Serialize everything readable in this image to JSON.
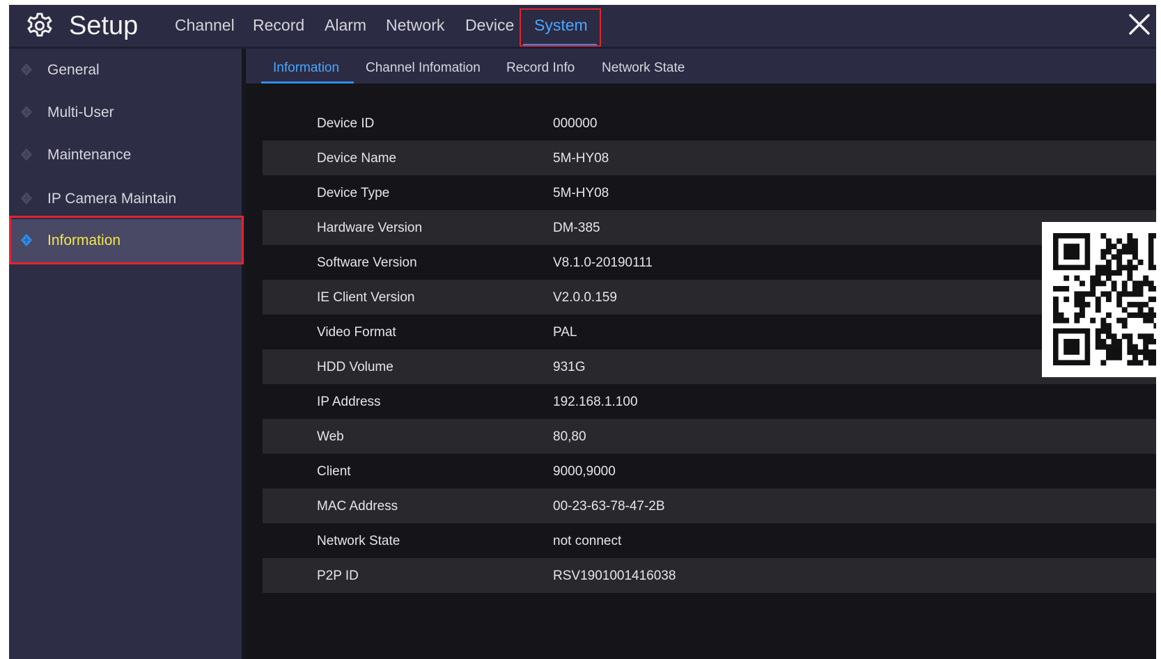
{
  "header": {
    "title": "Setup",
    "nav_tabs": [
      {
        "label": "Channel"
      },
      {
        "label": "Record"
      },
      {
        "label": "Alarm"
      },
      {
        "label": "Network"
      },
      {
        "label": "Device"
      },
      {
        "label": "System"
      }
    ],
    "active_tab": "System",
    "icons": {
      "settings": "gear-icon",
      "close": "close-icon"
    }
  },
  "sidebar": {
    "items": [
      {
        "label": "General"
      },
      {
        "label": "Multi-User"
      },
      {
        "label": "Maintenance"
      },
      {
        "label": "IP Camera Maintain"
      },
      {
        "label": "Information"
      }
    ],
    "active_item": "Information"
  },
  "subtabs": {
    "items": [
      {
        "label": "Information"
      },
      {
        "label": "Channel Infomation"
      },
      {
        "label": "Record Info"
      },
      {
        "label": "Network State"
      }
    ],
    "active": "Information"
  },
  "info": {
    "rows": [
      {
        "label": "Device ID",
        "value": "000000"
      },
      {
        "label": "Device Name",
        "value": "5M-HY08"
      },
      {
        "label": "Device Type",
        "value": "5M-HY08"
      },
      {
        "label": "Hardware Version",
        "value": "DM-385"
      },
      {
        "label": "Software Version",
        "value": "V8.1.0-20190111"
      },
      {
        "label": "IE Client Version",
        "value": "V2.0.0.159"
      },
      {
        "label": "Video Format",
        "value": "PAL"
      },
      {
        "label": "HDD Volume",
        "value": "931G"
      },
      {
        "label": "IP Address",
        "value": "192.168.1.100"
      },
      {
        "label": "Web",
        "value": "80,80"
      },
      {
        "label": "Client",
        "value": "9000,9000"
      },
      {
        "label": "MAC Address",
        "value": "00-23-63-78-47-2B"
      },
      {
        "label": "Network State",
        "value": "not connect"
      },
      {
        "label": "P2P ID",
        "value": "RSV1901001416038"
      }
    ]
  },
  "colors": {
    "accent": "#2f8fe8",
    "highlight_text": "#f3e64a",
    "frame": "#e0242f",
    "bar_bg": "#2b2b43",
    "content_bg": "#141419"
  }
}
